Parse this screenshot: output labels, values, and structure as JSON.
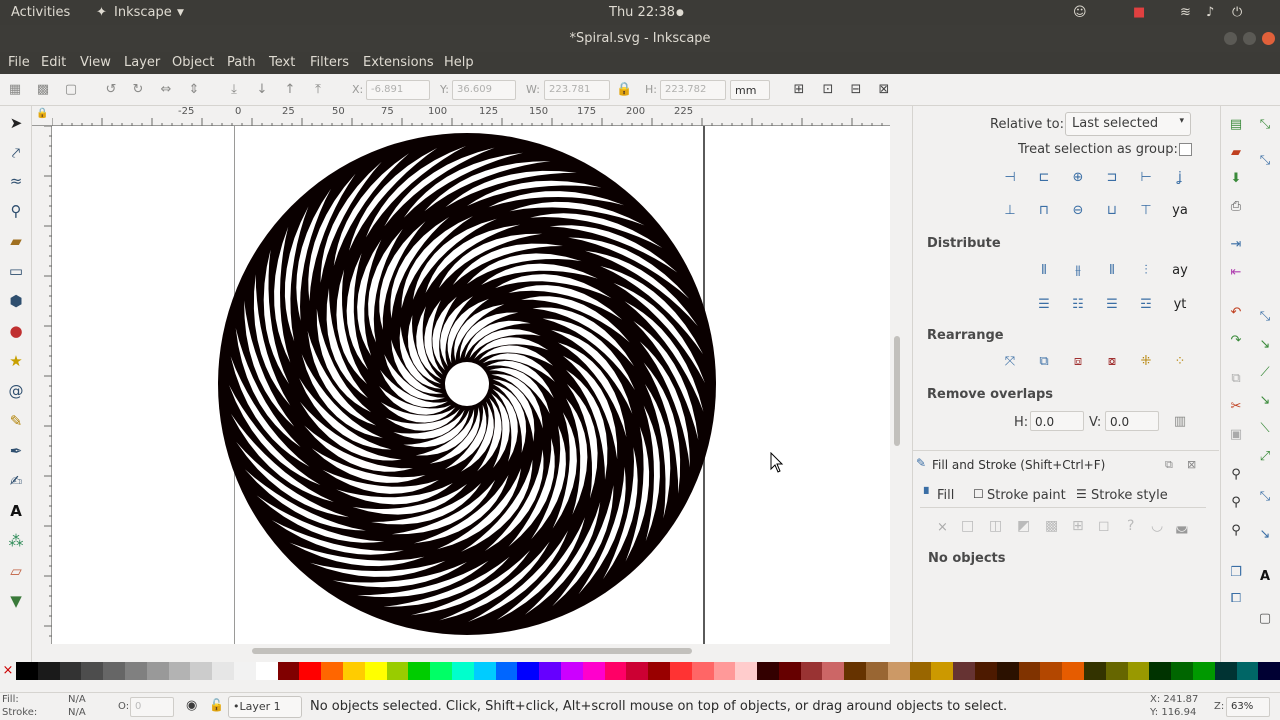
{
  "system": {
    "activities": "Activities",
    "app_menu": "Inkscape",
    "clock": "Thu 22:38"
  },
  "window": {
    "title": "*Spiral.svg - Inkscape"
  },
  "menu": {
    "items": [
      "File",
      "Edit",
      "View",
      "Layer",
      "Object",
      "Path",
      "Text",
      "Filters",
      "Extensions",
      "Help"
    ]
  },
  "toolbar": {
    "x_label": "X:",
    "x_value": "-6.891",
    "y_label": "Y:",
    "y_value": "36.609",
    "w_label": "W:",
    "w_value": "223.781",
    "h_label": "H:",
    "h_value": "223.782",
    "unit": "mm"
  },
  "ruler": {
    "ticks": [
      "-25",
      "0",
      "25",
      "50",
      "75",
      "100",
      "125",
      "150",
      "175",
      "200",
      "225"
    ]
  },
  "align_panel": {
    "relative_label": "Relative to:",
    "relative_value": "Last selected",
    "treat_group_label": "Treat selection as group:",
    "distribute_heading": "Distribute",
    "rearrange_heading": "Rearrange",
    "remove_overlaps_heading": "Remove overlaps",
    "h_label": "H:",
    "h_value": "0.0",
    "v_label": "V:",
    "v_value": "0.0"
  },
  "fill_stroke_panel": {
    "title": "Fill and Stroke (Shift+Ctrl+F)",
    "tabs": [
      "Fill",
      "Stroke paint",
      "Stroke style"
    ],
    "status": "No objects"
  },
  "statusbar": {
    "fill_label": "Fill:",
    "fill_value": "N/A",
    "stroke_label": "Stroke:",
    "stroke_value": "N/A",
    "opacity_label": "O:",
    "opacity_value": "0",
    "layer": "•Layer 1",
    "message": "No objects selected. Click, Shift+click, Alt+scroll mouse on top of objects, or drag around objects to select.",
    "cursor_x": "X: 241.87",
    "cursor_y": "Y: 116.94",
    "zoom_label": "Z:",
    "zoom_value": "63%"
  },
  "palette": [
    "#000000",
    "#1a1a1a",
    "#333333",
    "#4d4d4d",
    "#666666",
    "#808080",
    "#999999",
    "#b3b3b3",
    "#cccccc",
    "#e6e6e6",
    "#f2f2f2",
    "#ffffff",
    "#800000",
    "#ff0000",
    "#ff6600",
    "#ffcc00",
    "#ffff00",
    "#99cc00",
    "#00cc00",
    "#00ff66",
    "#00ffcc",
    "#00ccff",
    "#0066ff",
    "#0000ff",
    "#6600ff",
    "#cc00ff",
    "#ff00cc",
    "#ff0066",
    "#cc0033",
    "#990000",
    "#ff3333",
    "#ff6666",
    "#ff9999",
    "#ffcccc",
    "#330000",
    "#660000",
    "#993333",
    "#cc6666",
    "#663300",
    "#996633",
    "#cc9966",
    "#996600",
    "#cc9900",
    "#663333",
    "#4d1a00",
    "#2b1100",
    "#803300",
    "#b34700",
    "#e65c00",
    "#333300",
    "#666600",
    "#999900",
    "#003300",
    "#006600",
    "#009900",
    "#003333",
    "#006666",
    "#000033"
  ]
}
